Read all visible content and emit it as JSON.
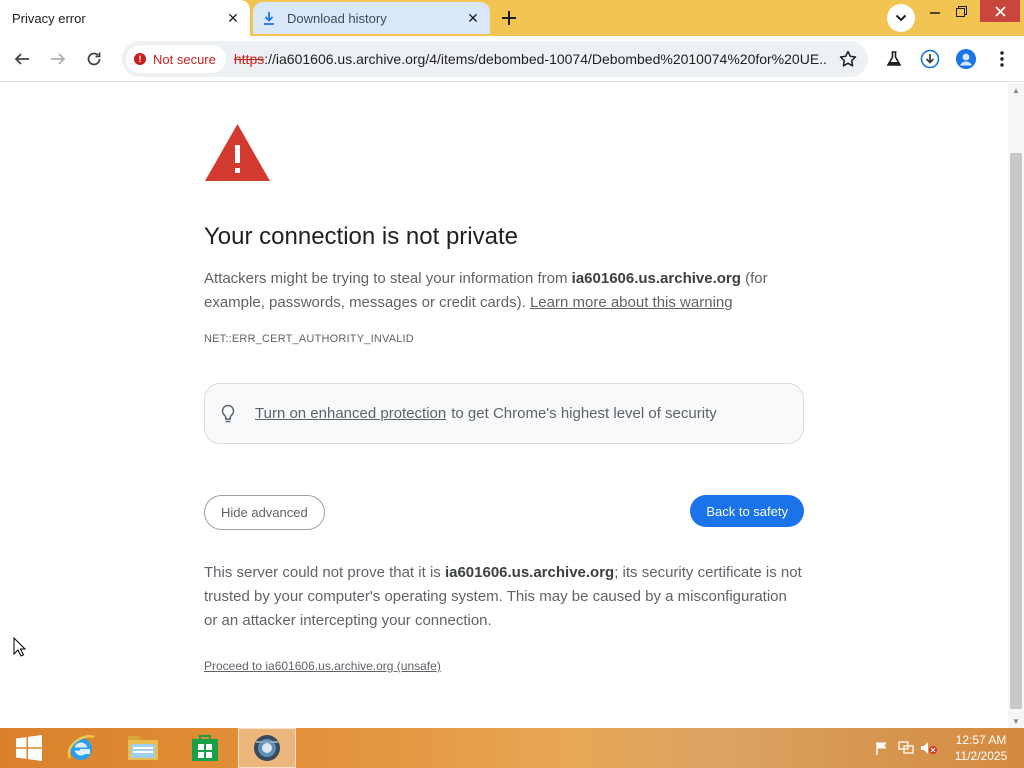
{
  "browser": {
    "tabs": [
      {
        "title": "Privacy error",
        "active": true
      },
      {
        "title": "Download history",
        "active": false,
        "icon": "download-icon"
      }
    ],
    "omnibox": {
      "security_label": "Not secure",
      "url_scheme": "https",
      "url_rest": "://ia601606.us.archive.org/4/items/debombed-10074/Debombed%2010074%20for%20UE..."
    }
  },
  "page": {
    "heading": "Your connection is not private",
    "intro_before": "Attackers might be trying to steal your information from ",
    "intro_host": "ia601606.us.archive.org",
    "intro_after": " (for example, passwords, messages or credit cards). ",
    "learn_more": "Learn more about this warning",
    "error_code": "NET::ERR_CERT_AUTHORITY_INVALID",
    "enhanced_link": "Turn on enhanced protection",
    "enhanced_text": "to get Chrome's highest level of security",
    "hide_advanced": "Hide advanced",
    "back_to_safety": "Back to safety",
    "details_before": "This server could not prove that it is ",
    "details_host": "ia601606.us.archive.org",
    "details_after": "; its security certificate is not trusted by your computer's operating system. This may be caused by a misconfiguration or an attacker intercepting your connection.",
    "proceed_link": "Proceed to ia601606.us.archive.org (unsafe)"
  },
  "taskbar": {
    "time": "12:57 AM",
    "date": "11/2/2025"
  },
  "colors": {
    "tabstrip": "#f2c553",
    "accent_blue": "#1a73e8",
    "danger_red": "#c5221f",
    "warning_triangle": "#d33a2f"
  }
}
